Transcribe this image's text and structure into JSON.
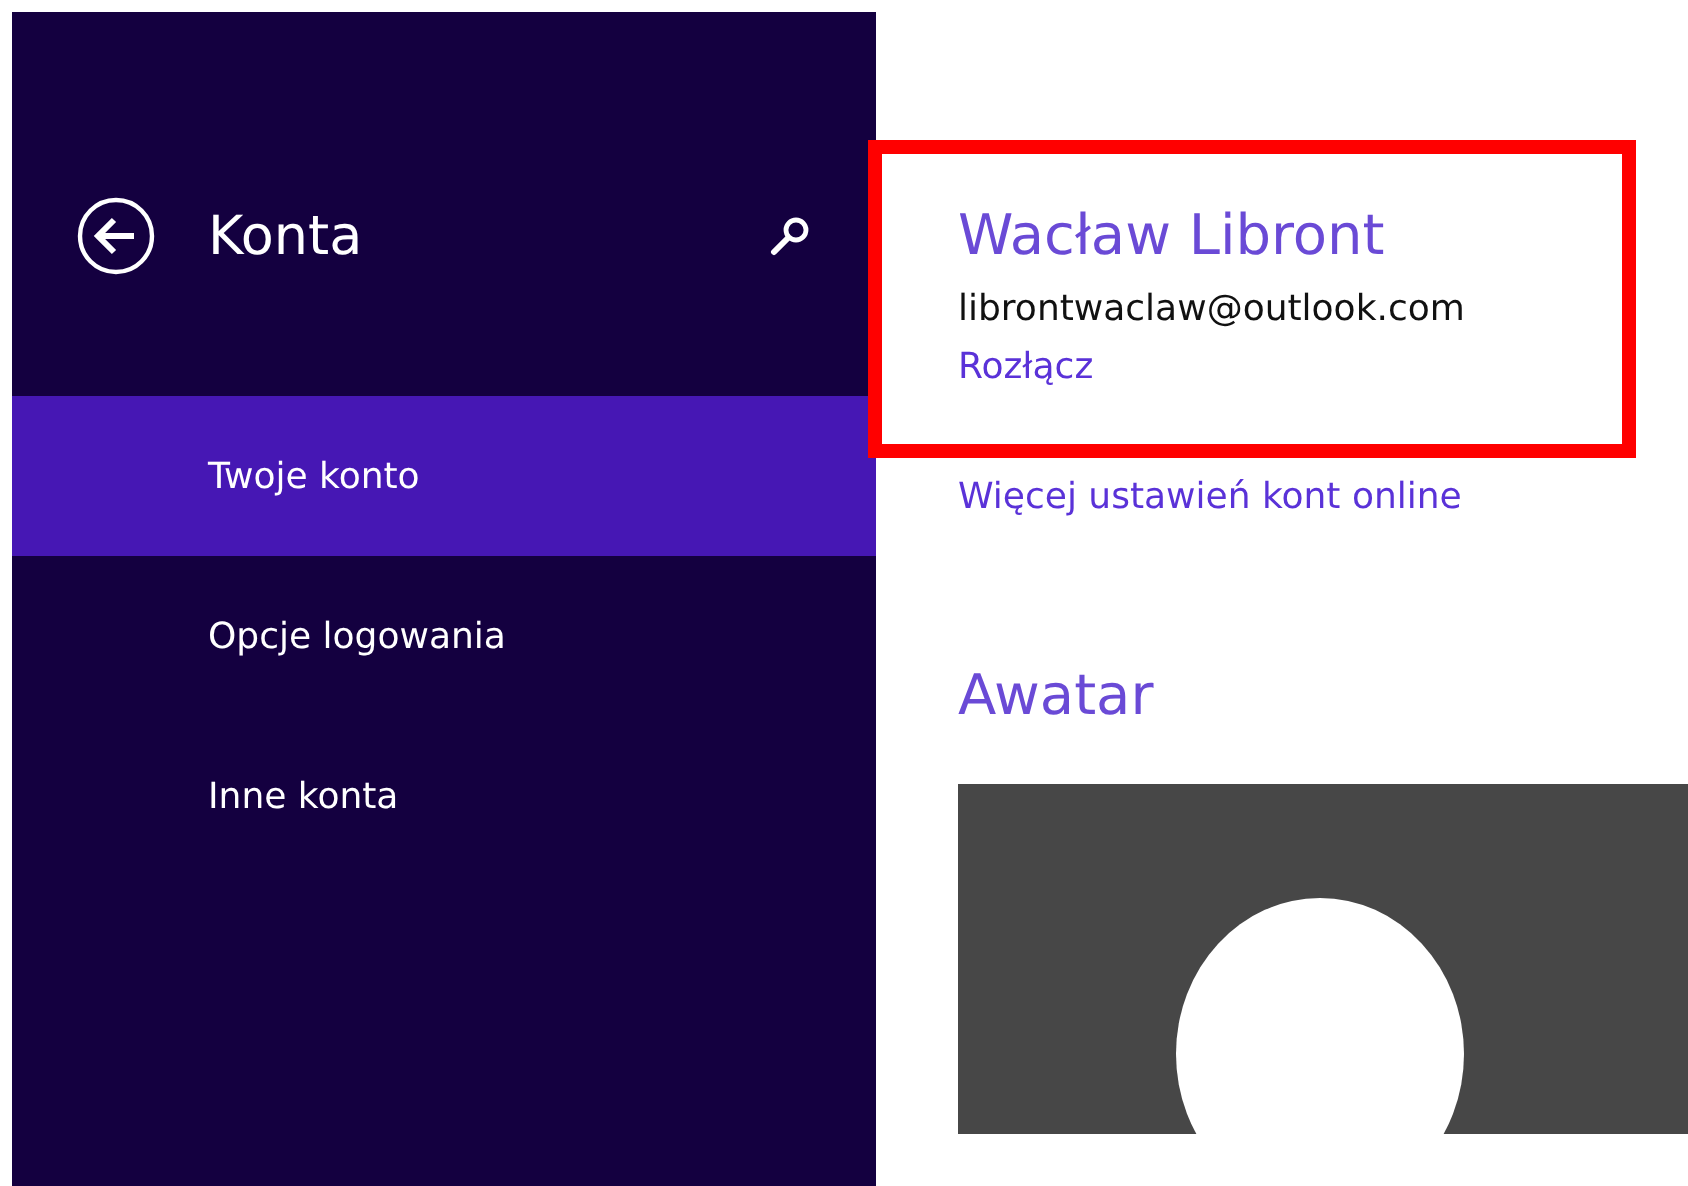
{
  "sidebar": {
    "title": "Konta",
    "items": [
      {
        "label": "Twoje konto",
        "selected": true
      },
      {
        "label": "Opcje logowania",
        "selected": false
      },
      {
        "label": "Inne konta",
        "selected": false
      }
    ]
  },
  "account": {
    "name": "Wacław Libront",
    "email": "librontwaclaw@outlook.com",
    "disconnect": "Rozłącz",
    "highlighted": true
  },
  "more_link": "Więcej ustawień kont online",
  "avatar_heading": "Awatar"
}
